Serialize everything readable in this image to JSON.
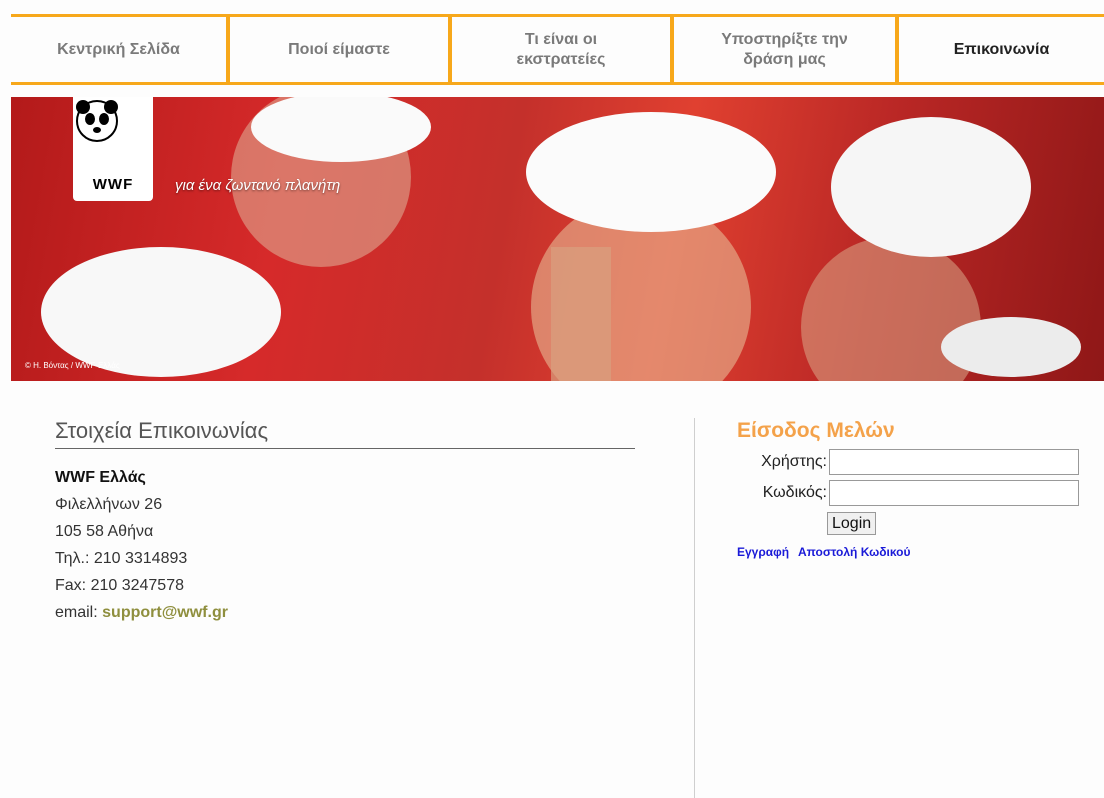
{
  "nav": [
    {
      "label": "Κεντρική Σελίδα"
    },
    {
      "label": "Ποιοί είμαστε"
    },
    {
      "label": "Τι είναι οι\nεκστρατείες"
    },
    {
      "label": "Υποστηρίξτε την\nδράση μας"
    },
    {
      "label": "Επικοινωνία"
    }
  ],
  "banner": {
    "logo_text": "WWF",
    "tagline": "για ένα ζωντανό πλανήτη",
    "credit": "© Η. Βόντας / WWF-Ελλάς"
  },
  "contact": {
    "title": "Στοιχεία Επικοινωνίας",
    "org": "WWF Ελλάς",
    "address1": "Φιλελλήνων 26",
    "address2": "105 58 Αθήνα",
    "phone": "Τηλ.: 210 3314893",
    "fax": "Fax: 210 3247578",
    "email_label": "email:",
    "email": "support@wwf.gr"
  },
  "login": {
    "title": "Είσοδος Μελών",
    "user_label": "Χρήστης:",
    "user_value": "",
    "pass_label": "Κωδικός:",
    "pass_value": "",
    "button": "Login",
    "register": "Εγγραφή",
    "send_password": "Αποστολή Κωδικού"
  },
  "colors": {
    "accent": "#f7a81b",
    "login_title": "#f4a24a",
    "link": "#1a1ad8",
    "email": "#8f8f3e"
  }
}
